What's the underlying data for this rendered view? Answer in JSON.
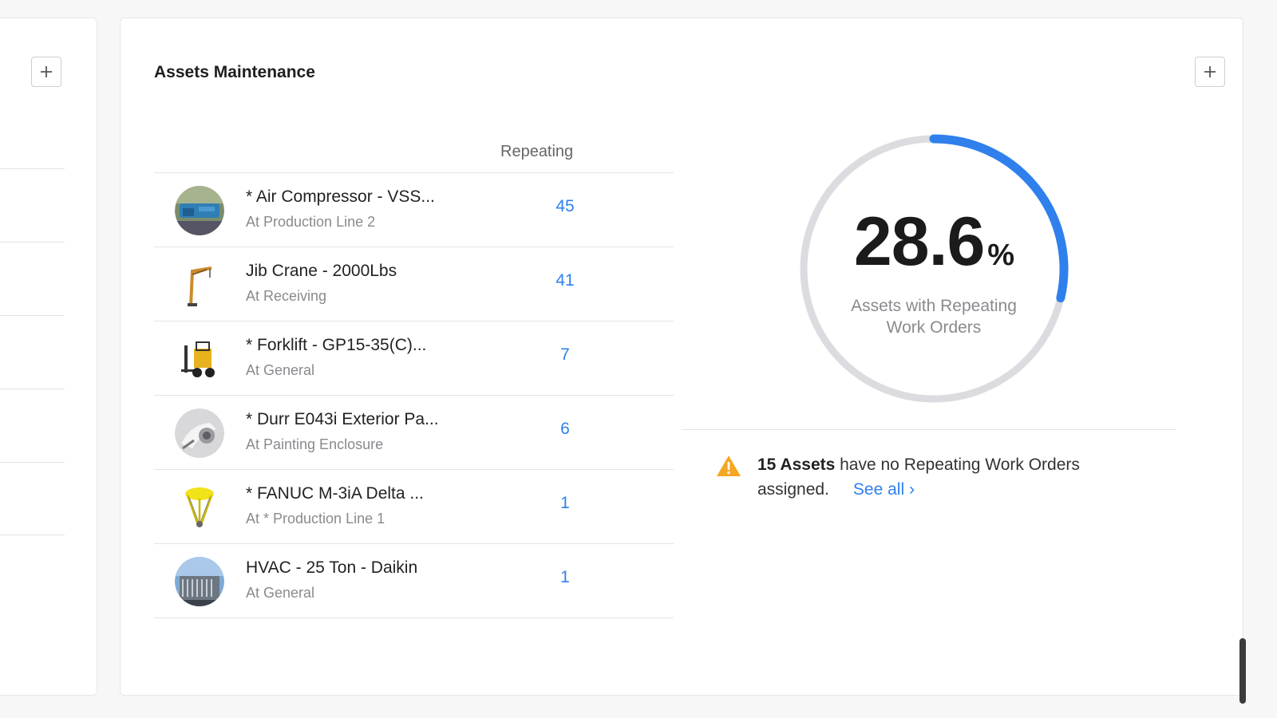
{
  "widget": {
    "title": "Assets Maintenance",
    "column_header": "Repeating"
  },
  "assets": [
    {
      "name": "* Air Compressor - VSS...",
      "location": "At Production Line 2",
      "count": "45"
    },
    {
      "name": "Jib Crane - 2000Lbs",
      "location": "At Receiving",
      "count": "41"
    },
    {
      "name": "* Forklift - GP15-35(C)...",
      "location": "At General",
      "count": "7"
    },
    {
      "name": "* Durr E043i Exterior Pa...",
      "location": "At Painting Enclosure",
      "count": "6"
    },
    {
      "name": "* FANUC M-3iA Delta ...",
      "location": "At * Production Line 1",
      "count": "1"
    },
    {
      "name": "HVAC - 25 Ton - Daikin",
      "location": "At General",
      "count": "1"
    }
  ],
  "gauge": {
    "value": "28.6",
    "unit": "%",
    "fraction": 0.286,
    "caption": "Assets with Repeating Work Orders",
    "track_color": "#dcdce0",
    "fill_color": "#2f80ed"
  },
  "notice": {
    "count_label": "15 Assets",
    "text": " have no Repeating Work Orders assigned.",
    "link": "See all ›"
  },
  "icons": {
    "add": "plus-icon",
    "warning": "warning-triangle-icon"
  }
}
